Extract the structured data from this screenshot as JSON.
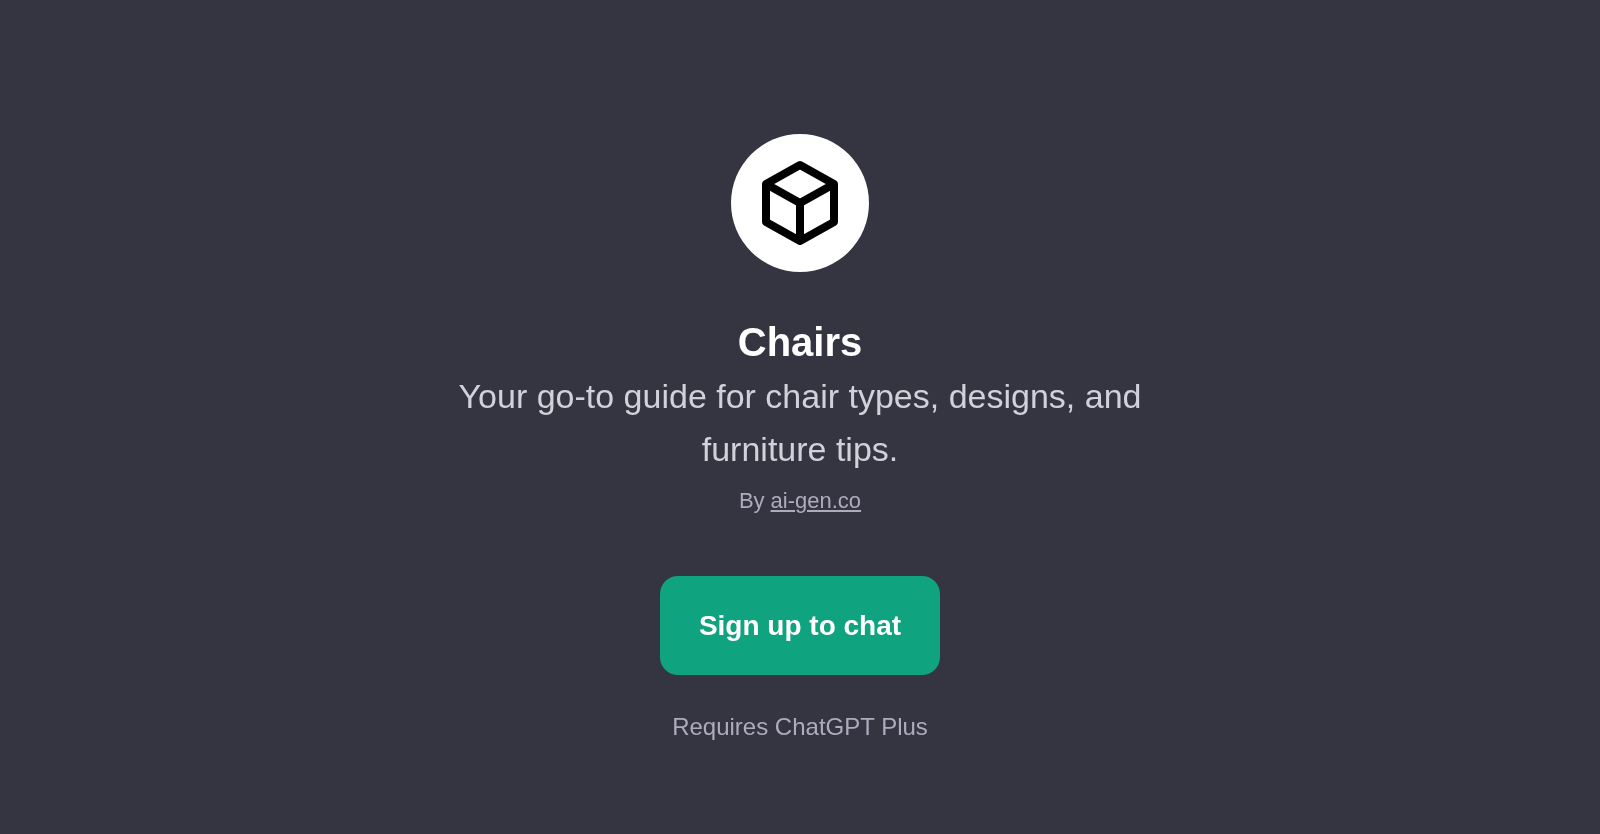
{
  "title": "Chairs",
  "description": "Your go-to guide for chair types, designs, and furniture tips.",
  "author": {
    "prefix": "By",
    "link": "ai-gen.co"
  },
  "button": {
    "label": "Sign up to chat"
  },
  "note": "Requires ChatGPT Plus"
}
